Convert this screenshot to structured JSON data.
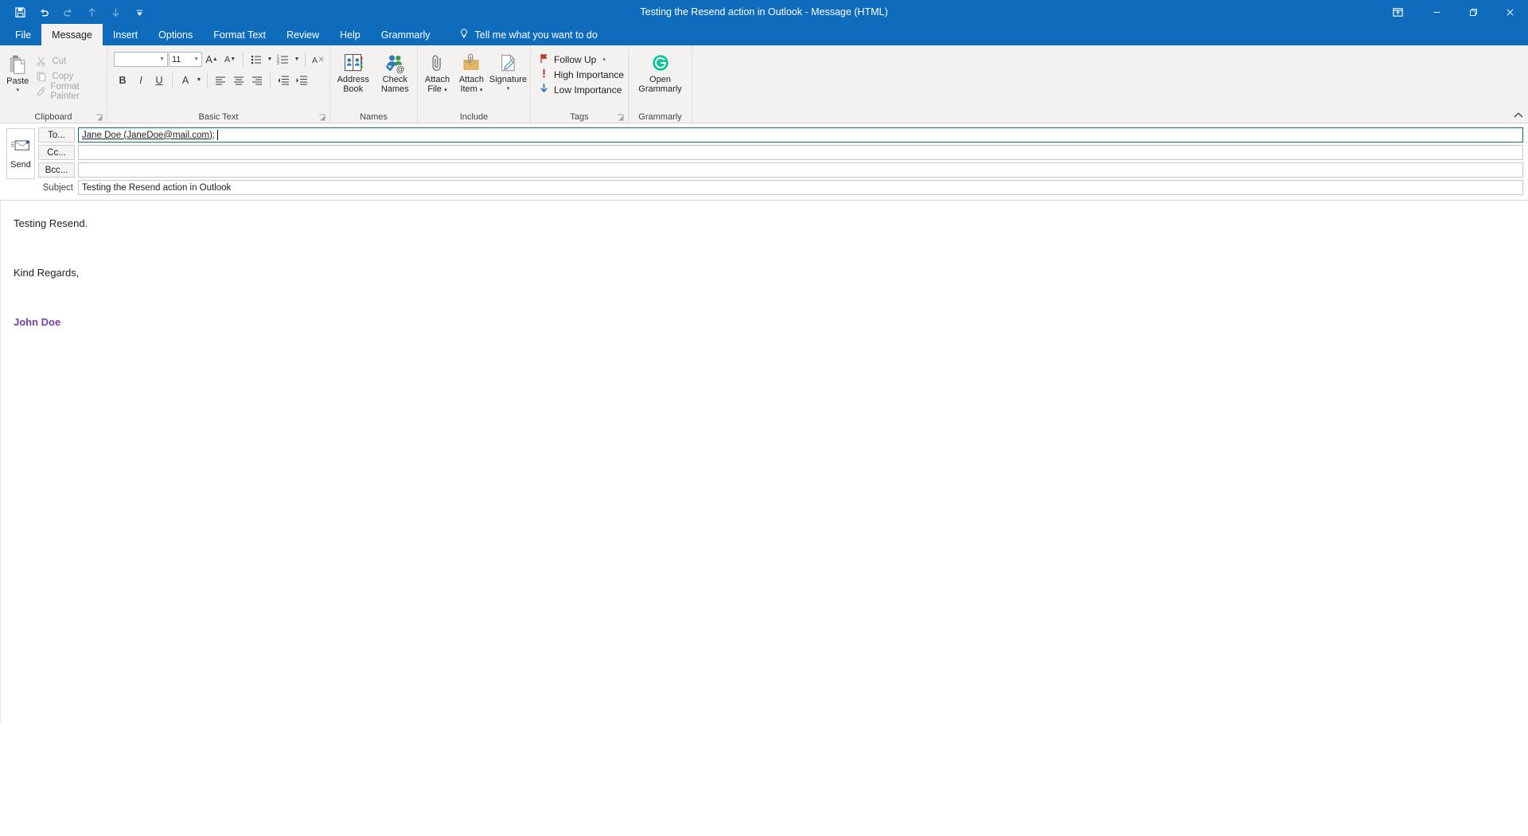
{
  "window": {
    "title": "Testing the Resend action in Outlook  -  Message (HTML)",
    "accent_color": "#0f6cbd",
    "quick_access": [
      {
        "name": "save-button",
        "label": "Save",
        "icon": "save-icon",
        "enabled": true
      },
      {
        "name": "undo-button",
        "label": "Undo",
        "icon": "undo-icon",
        "enabled": true
      },
      {
        "name": "redo-button",
        "label": "Redo",
        "icon": "redo-icon",
        "enabled": false
      },
      {
        "name": "previous-item-button",
        "label": "Previous Item",
        "icon": "arrow-up-icon",
        "enabled": false
      },
      {
        "name": "next-item-button",
        "label": "Next Item",
        "icon": "arrow-down-icon",
        "enabled": false
      },
      {
        "name": "customize-quick-access-toolbar-button",
        "label": "Customize Quick Access Toolbar",
        "icon": "chevron-down-icon",
        "enabled": true
      }
    ],
    "controls": [
      {
        "name": "ribbon-display-options-button",
        "label": "Ribbon Display Options",
        "icon": "ribbon-display-icon"
      },
      {
        "name": "minimize-button",
        "label": "Minimize",
        "icon": "minimize-icon"
      },
      {
        "name": "restore-button",
        "label": "Restore Down",
        "icon": "restore-icon"
      },
      {
        "name": "close-button",
        "label": "Close",
        "icon": "close-icon"
      }
    ]
  },
  "tabs": [
    {
      "label": "File",
      "active": false
    },
    {
      "label": "Message",
      "active": true
    },
    {
      "label": "Insert",
      "active": false
    },
    {
      "label": "Options",
      "active": false
    },
    {
      "label": "Format Text",
      "active": false
    },
    {
      "label": "Review",
      "active": false
    },
    {
      "label": "Help",
      "active": false
    },
    {
      "label": "Grammarly",
      "active": false
    }
  ],
  "tell_me": {
    "label": "Tell me what you want to do",
    "icon": "lightbulb-icon"
  },
  "ribbon": {
    "collapse_label": "⌃",
    "groups": {
      "clipboard": {
        "label": "Clipboard",
        "paste": {
          "label": "Paste",
          "caret": "▾"
        },
        "cut": {
          "label": "Cut",
          "icon": "scissors-icon",
          "disabled": true
        },
        "copy": {
          "label": "Copy",
          "icon": "copy-icon",
          "disabled": true
        },
        "format_painter": {
          "label": "Format Painter",
          "icon": "paintbrush-icon",
          "disabled": true
        }
      },
      "basic_text": {
        "label": "Basic Text",
        "font_name": "",
        "font_size": "11",
        "grow_font": "A",
        "shrink_font": "A",
        "bullets": "•—",
        "numbering": "1—",
        "clear_formatting": "A",
        "bold": "B",
        "italic": "I",
        "underline": "U",
        "font_color": "A",
        "align_left": "align-left",
        "align_center": "align-center",
        "align_right": "align-right",
        "decrease_indent": "decrease-indent",
        "increase_indent": "increase-indent"
      },
      "names": {
        "label": "Names",
        "address_book": {
          "line1": "Address",
          "line2": "Book"
        },
        "check_names": {
          "line1": "Check",
          "line2": "Names"
        }
      },
      "include": {
        "label": "Include",
        "attach_file": {
          "line1": "Attach",
          "line2": "File",
          "caret": "▾"
        },
        "attach_item": {
          "line1": "Attach",
          "line2": "Item",
          "caret": "▾"
        },
        "signature": {
          "line1": "Signature",
          "line2": "",
          "caret": "▾"
        }
      },
      "tags": {
        "label": "Tags",
        "follow_up": {
          "label": "Follow Up",
          "icon": "flag-icon",
          "caret": "▾",
          "color": "#c0392b"
        },
        "high_importance": {
          "label": "High Importance",
          "icon": "exclamation-icon",
          "color": "#c0392b"
        },
        "low_importance": {
          "label": "Low Importance",
          "icon": "arrow-down-icon",
          "color": "#1f6fb2"
        }
      },
      "grammarly": {
        "label": "Grammarly",
        "open": {
          "line1": "Open",
          "line2": "Grammarly",
          "icon": "grammarly-logo-icon",
          "color": "#15c39a"
        }
      }
    }
  },
  "compose": {
    "send_button": {
      "label": "Send",
      "icon": "send-envelope-icon"
    },
    "fields": [
      {
        "name": "to",
        "button_label": "To...",
        "value": "Jane Doe (JaneDoe@mail.com);",
        "focused": true,
        "underlined": true
      },
      {
        "name": "cc",
        "button_label": "Cc...",
        "value": "",
        "focused": false,
        "underlined": false
      },
      {
        "name": "bcc",
        "button_label": "Bcc...",
        "value": "",
        "focused": false,
        "underlined": false
      }
    ],
    "subject": {
      "label": "Subject",
      "value": "Testing the Resend action in Outlook"
    },
    "body": {
      "lines": [
        {
          "text": "Testing Resend.",
          "style": "normal"
        },
        {
          "text": "",
          "style": "normal"
        },
        {
          "text": "Kind Regards,",
          "style": "normal"
        },
        {
          "text": "",
          "style": "normal"
        },
        {
          "text": "John Doe",
          "style": "signature"
        }
      ],
      "signature_color": "#7442a4"
    }
  }
}
